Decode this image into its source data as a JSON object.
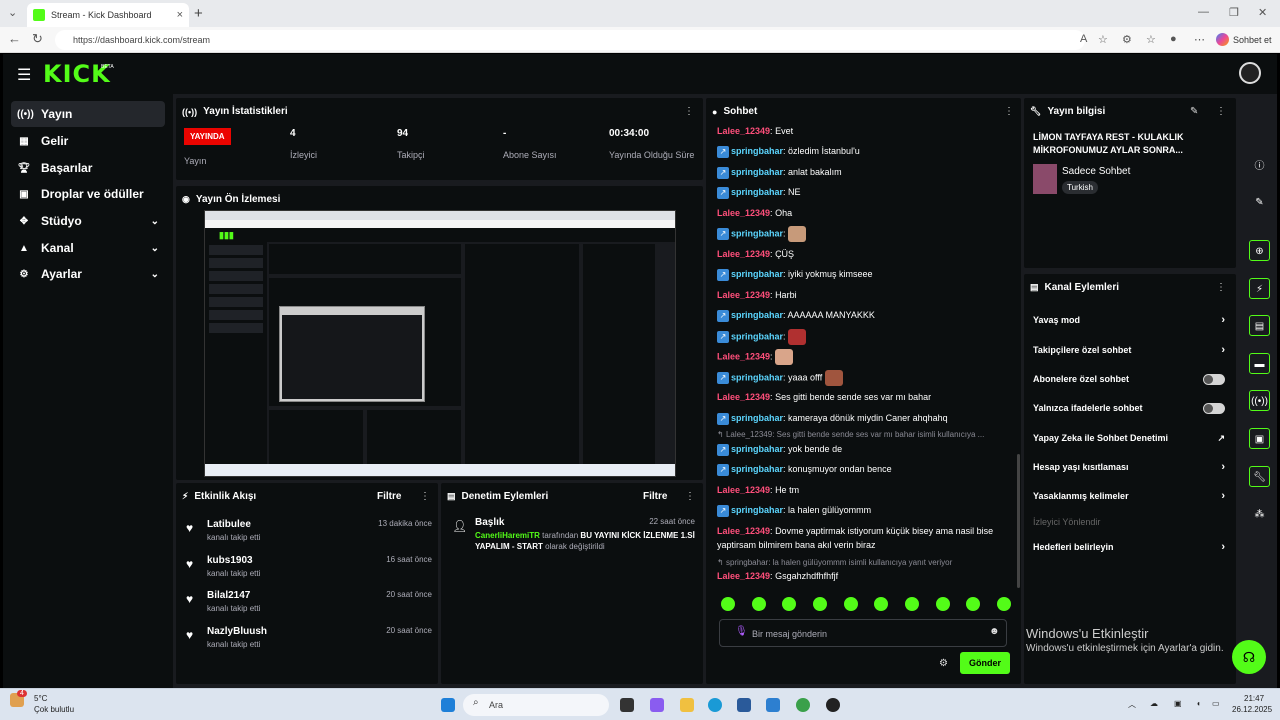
{
  "browser": {
    "tab_title": "Stream - Kick Dashboard",
    "url": "https://dashboard.kick.com/stream",
    "copilot": "Sohbet et"
  },
  "app": {
    "logo": "KICK",
    "beta": "BETA"
  },
  "sidebar": {
    "items": [
      {
        "label": "Yayın",
        "icon": "broadcast-icon"
      },
      {
        "label": "Gelir",
        "icon": "income-icon"
      },
      {
        "label": "Başarılar",
        "icon": "trophy-icon"
      },
      {
        "label": "Droplar ve ödüller",
        "icon": "gift-icon"
      },
      {
        "label": "Stüdyo",
        "icon": "studio-icon"
      },
      {
        "label": "Kanal",
        "icon": "channel-icon"
      },
      {
        "label": "Ayarlar",
        "icon": "gear-icon"
      }
    ]
  },
  "stats": {
    "title": "Yayın İstatistikleri",
    "live_badge": "YAYINDA",
    "live_label": "Yayın",
    "viewers": "4",
    "viewers_label": "İzleyici",
    "followers": "94",
    "followers_label": "Takipçi",
    "subs": "-",
    "subs_label": "Abone Sayısı",
    "duration": "00:34:00",
    "duration_label": "Yayında Olduğu Süre"
  },
  "preview": {
    "title": "Yayın Ön İzlemesi"
  },
  "events": {
    "title": "Etkinlik Akışı",
    "filter": "Filtre",
    "items": [
      {
        "name": "Latibulee",
        "sub": "kanalı takip etti",
        "time": "13 dakika önce"
      },
      {
        "name": "kubs1903",
        "sub": "kanalı takip etti",
        "time": "16 saat önce"
      },
      {
        "name": "Bilal2147",
        "sub": "kanalı takip etti",
        "time": "20 saat önce"
      },
      {
        "name": "NazlyBluush",
        "sub": "kanalı takip etti",
        "time": "20 saat önce"
      }
    ]
  },
  "moderation": {
    "title": "Denetim Eylemleri",
    "filter": "Filtre",
    "item_title": "Başlık",
    "item_time": "22 saat önce",
    "actor": "CanerliHaremiTR",
    "by": "tarafından",
    "value": "BU YAYINI KİCK İZLENME 1.Sİ YAPALIM - START",
    "changed": "olarak değiştirildi"
  },
  "chat": {
    "title": "Sohbet",
    "messages": [
      {
        "user": "Lalee_12349",
        "c": "r",
        "text": "Evet"
      },
      {
        "user": "springbahar",
        "c": "g",
        "text": "özledim İstanbul'u"
      },
      {
        "user": "springbahar",
        "c": "g",
        "text": "anlat bakalım"
      },
      {
        "user": "springbahar",
        "c": "g",
        "text": "NE"
      },
      {
        "user": "Lalee_12349",
        "c": "r",
        "text": "Oha"
      },
      {
        "user": "springbahar",
        "c": "g",
        "text": ""
      },
      {
        "user": "Lalee_12349",
        "c": "r",
        "text": "ÇÜŞ"
      },
      {
        "user": "springbahar",
        "c": "g",
        "text": "iyiki yokmuş kimseee"
      },
      {
        "user": "Lalee_12349",
        "c": "r",
        "text": "Harbi"
      },
      {
        "user": "springbahar",
        "c": "g",
        "text": "AAAAAA MANYAKKK"
      },
      {
        "user": "springbahar",
        "c": "g",
        "text": ""
      },
      {
        "user": "Lalee_12349",
        "c": "r",
        "text": ""
      },
      {
        "user": "springbahar",
        "c": "g",
        "text": "yaaa offf"
      },
      {
        "user": "Lalee_12349",
        "c": "r",
        "text": "Ses gitti bende sende ses var mı bahar"
      },
      {
        "user": "springbahar",
        "c": "g",
        "text": "kameraya dönük miydin Caner ahqhahq"
      }
    ],
    "reply1": "Lalee_12349: Ses gitti bende sende ses var mı bahar isimli kullanıcıya ...",
    "messages2": [
      {
        "user": "springbahar",
        "c": "g",
        "text": "yok bende de"
      },
      {
        "user": "springbahar",
        "c": "g",
        "text": "konuşmuyor ondan bence"
      },
      {
        "user": "Lalee_12349",
        "c": "r",
        "text": "He tm"
      },
      {
        "user": "springbahar",
        "c": "g",
        "text": "la halen gülüyommm"
      },
      {
        "user": "Lalee_12349",
        "c": "r",
        "text": "Dovme yaptirmak istiyorum küçük bisey ama nasil bise"
      }
    ],
    "wrap": "yaptirsam bilmirem bana akıl verin biraz",
    "reply2": "springbahar: la halen gülüyommm isimli kullanıcıya yanıt veriyor",
    "last": {
      "user": "Lalee_12349",
      "text": "Gsgahzhdfhfhfjf"
    },
    "input_placeholder": "Bir mesaj gönderin",
    "send": "Gönder"
  },
  "info": {
    "title": "Yayın bilgisi",
    "stream_title": "LİMON TAYFAYA REST - KULAKLIK MİKROFONUMUZ AYLAR SONRA...",
    "category": "Sadece Sohbet",
    "language": "Turkish"
  },
  "actions": {
    "title": "Kanal Eylemleri",
    "items": [
      {
        "label": "Yavaş mod",
        "kind": "arrow"
      },
      {
        "label": "Takipçilere özel sohbet",
        "kind": "arrow"
      },
      {
        "label": "Abonelere özel sohbet",
        "kind": "toggle"
      },
      {
        "label": "Yalnızca ifadelerle sohbet",
        "kind": "toggle"
      },
      {
        "label": "Yapay Zeka ile Sohbet Denetimi",
        "kind": "ext"
      },
      {
        "label": "Hesap yaşı kısıtlaması",
        "kind": "arrow"
      },
      {
        "label": "Yasaklanmış kelimeler",
        "kind": "arrow"
      },
      {
        "label": "İzleyici Yönlendir",
        "kind": "disabled"
      },
      {
        "label": "Hedefleri belirleyin",
        "kind": "arrow"
      }
    ]
  },
  "watermark": {
    "title": "Windows'u Etkinleştir",
    "sub": "Windows'u etkinleştirmek için Ayarlar'a gidin."
  },
  "taskbar": {
    "weather": "5°C",
    "weather_sub": "Çok bulutlu",
    "search": "Ara",
    "time": "21:47",
    "date": "26.12.2025",
    "badge": "4"
  }
}
